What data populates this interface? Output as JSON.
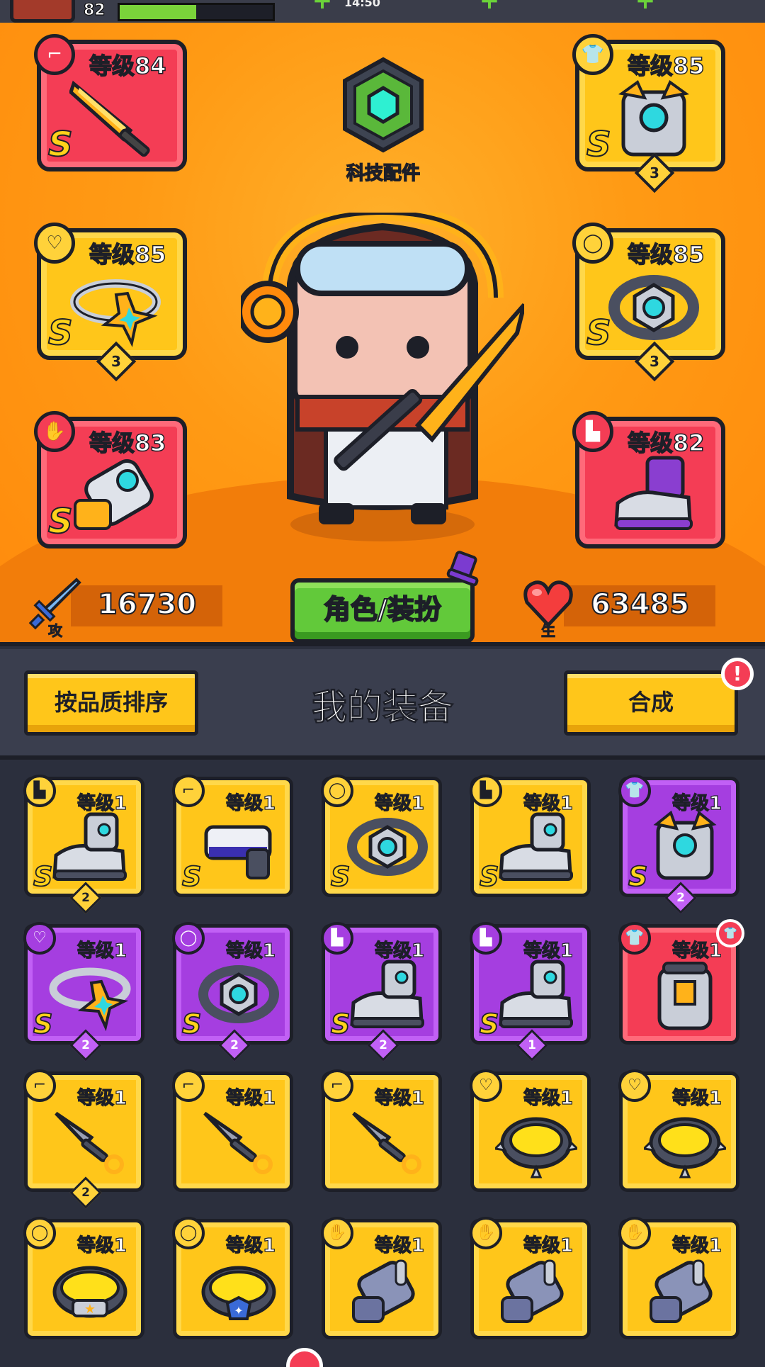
{
  "status_bar": {
    "player_level": "82",
    "xp_fraction": 0.5,
    "time": "14:50",
    "plus_icon": "plus-icon"
  },
  "hero": {
    "tech_label": "科技配件",
    "equipped": [
      {
        "slot": "weapon",
        "level": "等级84",
        "grade": "S",
        "rarity": "red",
        "stars": null,
        "icon": "gun-icon"
      },
      {
        "slot": "armor",
        "level": "等级85",
        "grade": "S",
        "rarity": "gold",
        "stars": "3",
        "icon": "shirt-icon"
      },
      {
        "slot": "necklace",
        "level": "等级85",
        "grade": "S",
        "rarity": "gold",
        "stars": "3",
        "icon": "necklace-icon"
      },
      {
        "slot": "belt",
        "level": "等级85",
        "grade": "S",
        "rarity": "gold",
        "stars": "3",
        "icon": "belt-icon"
      },
      {
        "slot": "gloves",
        "level": "等级83",
        "grade": "S",
        "rarity": "red",
        "stars": null,
        "icon": "glove-icon"
      },
      {
        "slot": "boots",
        "level": "等级82",
        "grade": "",
        "rarity": "red",
        "stars": null,
        "icon": "boot-icon"
      }
    ],
    "attack": {
      "label": "攻击",
      "value": "16730"
    },
    "health": {
      "label": "生命",
      "value": "63485"
    },
    "dress_button": "角色/装扮"
  },
  "equipment": {
    "sort_button": "按品质排序",
    "title": "我的装备",
    "merge_button": "合成",
    "alert_mark": "!",
    "items": [
      {
        "level": "等级1",
        "grade": "S",
        "rarity": "gold",
        "stars": "2",
        "icon": "boot-icon",
        "art": "boot"
      },
      {
        "level": "等级1",
        "grade": "S",
        "rarity": "gold",
        "stars": null,
        "icon": "gun-icon",
        "art": "gun"
      },
      {
        "level": "等级1",
        "grade": "S",
        "rarity": "gold",
        "stars": null,
        "icon": "belt-icon",
        "art": "belt"
      },
      {
        "level": "等级1",
        "grade": "S",
        "rarity": "gold",
        "stars": null,
        "icon": "boot-icon",
        "art": "boot"
      },
      {
        "level": "等级1",
        "grade": "S",
        "rarity": "purple",
        "stars": "2",
        "icon": "shirt-icon",
        "art": "armor"
      },
      {
        "level": "等级1",
        "grade": "S",
        "rarity": "purple",
        "stars": "2",
        "icon": "necklace-icon",
        "art": "necklace"
      },
      {
        "level": "等级1",
        "grade": "S",
        "rarity": "purple",
        "stars": "2",
        "icon": "belt-icon",
        "art": "belt"
      },
      {
        "level": "等级1",
        "grade": "S",
        "rarity": "purple",
        "stars": "2",
        "icon": "boot-icon",
        "art": "boot"
      },
      {
        "level": "等级1",
        "grade": "S",
        "rarity": "purple",
        "stars": "1",
        "icon": "boot-icon",
        "art": "boot"
      },
      {
        "level": "等级1",
        "grade": "",
        "rarity": "red",
        "stars": null,
        "icon": "shirt-icon",
        "art": "vest",
        "badge": true
      },
      {
        "level": "等级1",
        "grade": "",
        "rarity": "gold",
        "stars": "2",
        "icon": "gun-icon",
        "art": "kunai"
      },
      {
        "level": "等级1",
        "grade": "",
        "rarity": "gold",
        "stars": null,
        "icon": "gun-icon",
        "art": "kunai"
      },
      {
        "level": "等级1",
        "grade": "",
        "rarity": "gold",
        "stars": null,
        "icon": "gun-icon",
        "art": "kunai"
      },
      {
        "level": "等级1",
        "grade": "",
        "rarity": "gold",
        "stars": null,
        "icon": "necklace-icon",
        "art": "spikering"
      },
      {
        "level": "等级1",
        "grade": "",
        "rarity": "gold",
        "stars": null,
        "icon": "necklace-icon",
        "art": "spikering"
      },
      {
        "level": "等级1",
        "grade": "",
        "rarity": "gold",
        "stars": null,
        "icon": "belt-icon",
        "art": "ring-star"
      },
      {
        "level": "等级1",
        "grade": "",
        "rarity": "gold",
        "stars": null,
        "icon": "belt-icon",
        "art": "ring-blue"
      },
      {
        "level": "等级1",
        "grade": "",
        "rarity": "gold",
        "stars": null,
        "icon": "glove-icon",
        "art": "glove"
      },
      {
        "level": "等级1",
        "grade": "",
        "rarity": "gold",
        "stars": null,
        "icon": "glove-icon",
        "art": "glove"
      },
      {
        "level": "等级1",
        "grade": "",
        "rarity": "gold",
        "stars": null,
        "icon": "glove-icon",
        "art": "glove"
      }
    ]
  },
  "colors": {
    "gold": "#ffc61a",
    "purple": "#a53ee0",
    "red": "#f43d55",
    "green_button": "#62c93a",
    "background": "#2b2f3d",
    "hero_orange": "#ff9a14"
  }
}
